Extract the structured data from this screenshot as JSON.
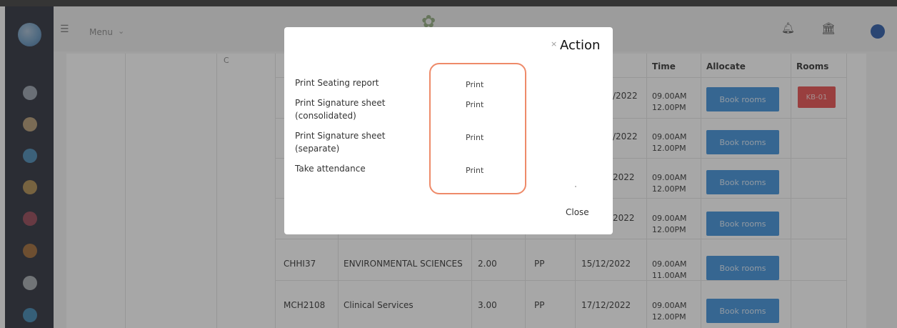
{
  "topbar": {
    "menu_label": "Menu",
    "icons": [
      "hamburger-icon",
      "chevron-down-icon",
      "bell-icon",
      "bank-icon"
    ]
  },
  "table": {
    "partial_header": "C",
    "headers": [
      "Time",
      "Allocate",
      "Rooms"
    ],
    "rows": [
      {
        "date_fragment": "/2022",
        "time_start": "09.00AM",
        "time_end": "12.00PM",
        "allocate": "Book rooms",
        "rooms": "KB-01"
      },
      {
        "date_fragment": "/2022",
        "time_start": "09.00AM",
        "time_end": "12.00PM",
        "allocate": "Book rooms"
      },
      {
        "date_fragment": "2022",
        "time_start": "09.00AM",
        "time_end": "12.00PM",
        "allocate": "Book rooms"
      },
      {
        "date_fragment": "2022",
        "time_start": "09.00AM",
        "time_end": "12.00PM",
        "allocate": "Book rooms"
      },
      {
        "code": "CHHI37",
        "title": "ENVIRONMENTAL SCIENCES",
        "credits": "2.00",
        "type": "PP",
        "date": "15/12/2022",
        "time_start": "09.00AM",
        "time_end": "11.00AM",
        "allocate": "Book rooms"
      },
      {
        "code": "MCH2108",
        "title": "Clinical Services",
        "credits": "3.00",
        "type": "PP",
        "date": "17/12/2022",
        "time_start": "09.00AM",
        "time_end": "12.00PM",
        "allocate": "Book rooms"
      }
    ]
  },
  "modal": {
    "close_x": "×",
    "title": "Action",
    "actions": [
      {
        "label": "Print Seating report",
        "button": "Print"
      },
      {
        "label": "Print Signature sheet (consolidated)",
        "button": "Print"
      },
      {
        "label": "Print Signature sheet (separate)",
        "button": "Print"
      },
      {
        "label": "Take attendance",
        "button": "Print"
      }
    ],
    "close_label": "Close"
  },
  "colors": {
    "sidebar": "#333846",
    "book_button": "#3d8fd9",
    "room_badge": "#e74d4d",
    "highlight": "#ee8a69"
  }
}
